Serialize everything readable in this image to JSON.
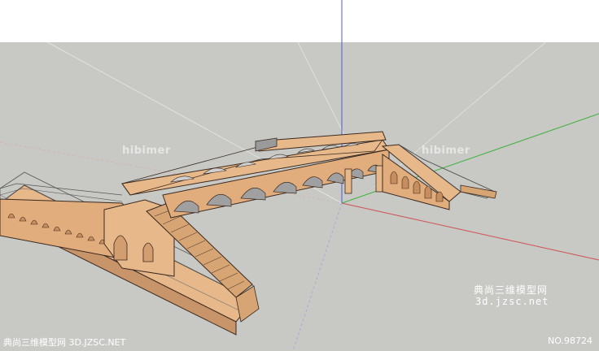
{
  "watermark": {
    "logo_text_1": "hibimer",
    "logo_text_2": "hibimer",
    "brand_cn": "典尚三维模型网",
    "brand_url": "3d.jzsc.net",
    "footer_left": "典尚三维模型网 3D.JZSC.NET",
    "footer_right": "NO.98724"
  },
  "axes": {
    "blue": "#4a5bd8",
    "red": "#d05050",
    "green": "#40b040"
  },
  "colors": {
    "ground": "#c8c8c4",
    "sky": "#ffffff",
    "stone": "#e7b88a",
    "stone_dark": "#c8946a",
    "edge": "#3a2a20"
  }
}
